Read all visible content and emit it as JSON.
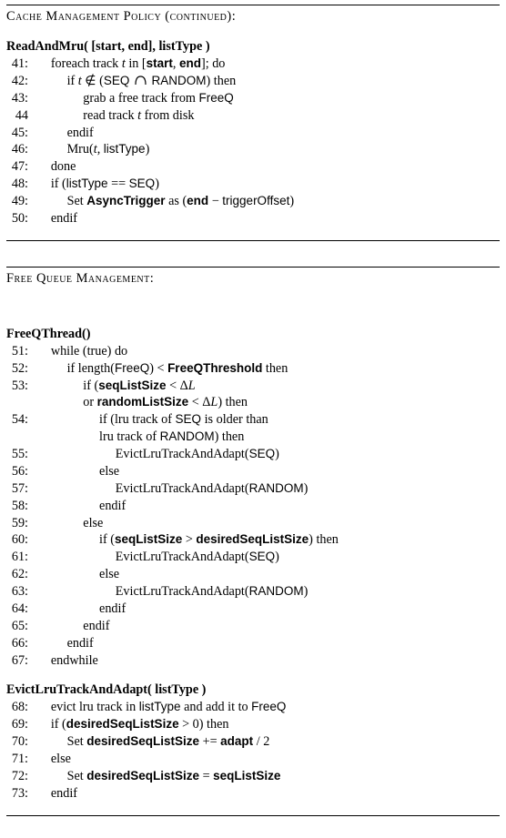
{
  "sectionA": {
    "title": "Cache Management Policy (continued):",
    "funcName": "ReadAndMru( [start, end], listType )",
    "lines": [
      {
        "num": "41:",
        "indent": 1,
        "html": "foreach track <span class='i'>t</span> in [<span class='sf b'>start</span>, <span class='sf b'>end</span>]; do"
      },
      {
        "num": "42:",
        "indent": 2,
        "html": "if <span class='i'>t</span> &notin; (<span class='sf'>SEQ</span> <svg class='svgd' width='17' height='14' viewBox='0 0 17 14'><path d='M3 13 Q3 4 8.5 4 Q14 4 14 13' stroke='#000' fill='none' stroke-width='1.2'/></svg> <span class='sf'>RANDOM</span>) then"
      },
      {
        "num": "43:",
        "indent": 3,
        "html": "grab a free track from <span class='sf'>FreeQ</span>"
      },
      {
        "num": "44",
        "indent": 3,
        "html": "read track <span class='i'>t</span> from disk"
      },
      {
        "num": "45:",
        "indent": 2,
        "html": "endif"
      },
      {
        "num": "46:",
        "indent": 2,
        "html": "Mru(<span class='i'>t</span>, <span class='sf'>listType</span>)"
      },
      {
        "num": "47:",
        "indent": 1,
        "html": "done"
      },
      {
        "num": "48:",
        "indent": 1,
        "html": "if (<span class='sf'>listType</span> == <span class='sf'>SEQ</span>)"
      },
      {
        "num": "49:",
        "indent": 2,
        "html": "Set <span class='sf b'>AsyncTrigger</span> as (<span class='sf b'>end</span> &minus; <span class='sf'>triggerOffset</span>)"
      },
      {
        "num": "50:",
        "indent": 1,
        "html": "endif"
      }
    ]
  },
  "sectionB": {
    "title": "Free Queue Management:",
    "funcName1": "FreeQThread()",
    "lines1": [
      {
        "num": "51:",
        "indent": 1,
        "html": "while (true) do"
      },
      {
        "num": "52:",
        "indent": 2,
        "html": "if length(<span class='sf'>FreeQ</span>) &lt; <span class='sf b'>FreeQThreshold</span> then"
      },
      {
        "num": "53:",
        "indent": 3,
        "html": "if (<span class='sf b'>seqListSize</span> &lt; &Delta;<span class='i'>L</span>"
      },
      {
        "num": "",
        "indent": 3,
        "html": "or <span class='sf b'>randomListSize</span> &lt; &Delta;<span class='i'>L</span>) then"
      },
      {
        "num": "54:",
        "indent": 4,
        "html": "if (lru track of <span class='sf'>SEQ</span> is older than"
      },
      {
        "num": "",
        "indent": 4,
        "html": "lru track of <span class='sf'>RANDOM</span>) then"
      },
      {
        "num": "55:",
        "indent": 5,
        "html": "EvictLruTrackAndAdapt(<span class='sf'>SEQ</span>)"
      },
      {
        "num": "56:",
        "indent": 4,
        "html": "else"
      },
      {
        "num": "57:",
        "indent": 5,
        "html": "EvictLruTrackAndAdapt(<span class='sf'>RANDOM</span>)"
      },
      {
        "num": "58:",
        "indent": 4,
        "html": "endif"
      },
      {
        "num": "59:",
        "indent": 3,
        "html": "else"
      },
      {
        "num": "60:",
        "indent": 4,
        "html": "if (<span class='sf b'>seqListSize</span> &gt; <span class='sf b'>desiredSeqListSize</span>) then"
      },
      {
        "num": "61:",
        "indent": 5,
        "html": "EvictLruTrackAndAdapt(<span class='sf'>SEQ</span>)"
      },
      {
        "num": "62:",
        "indent": 4,
        "html": "else"
      },
      {
        "num": "63:",
        "indent": 5,
        "html": "EvictLruTrackAndAdapt(<span class='sf'>RANDOM</span>)"
      },
      {
        "num": "64:",
        "indent": 4,
        "html": "endif"
      },
      {
        "num": "65:",
        "indent": 3,
        "html": "endif"
      },
      {
        "num": "66:",
        "indent": 2,
        "html": "endif"
      },
      {
        "num": "67:",
        "indent": 1,
        "html": "endwhile"
      }
    ],
    "funcName2": "EvictLruTrackAndAdapt( listType )",
    "lines2": [
      {
        "num": "68:",
        "indent": 1,
        "html": "evict lru track in <span class='sf'>listType</span> and add it to <span class='sf'>FreeQ</span>"
      },
      {
        "num": "69:",
        "indent": 1,
        "html": "if (<span class='sf b'>desiredSeqListSize</span> &gt; 0) then"
      },
      {
        "num": "70:",
        "indent": 2,
        "html": "Set <span class='sf b'>desiredSeqListSize</span> += <span class='sf b'>adapt</span> / 2"
      },
      {
        "num": "71:",
        "indent": 1,
        "html": "else"
      },
      {
        "num": "72:",
        "indent": 2,
        "html": "Set <span class='sf b'>desiredSeqListSize</span> = <span class='sf b'>seqListSize</span>"
      },
      {
        "num": "73:",
        "indent": 1,
        "html": "endif"
      }
    ]
  }
}
